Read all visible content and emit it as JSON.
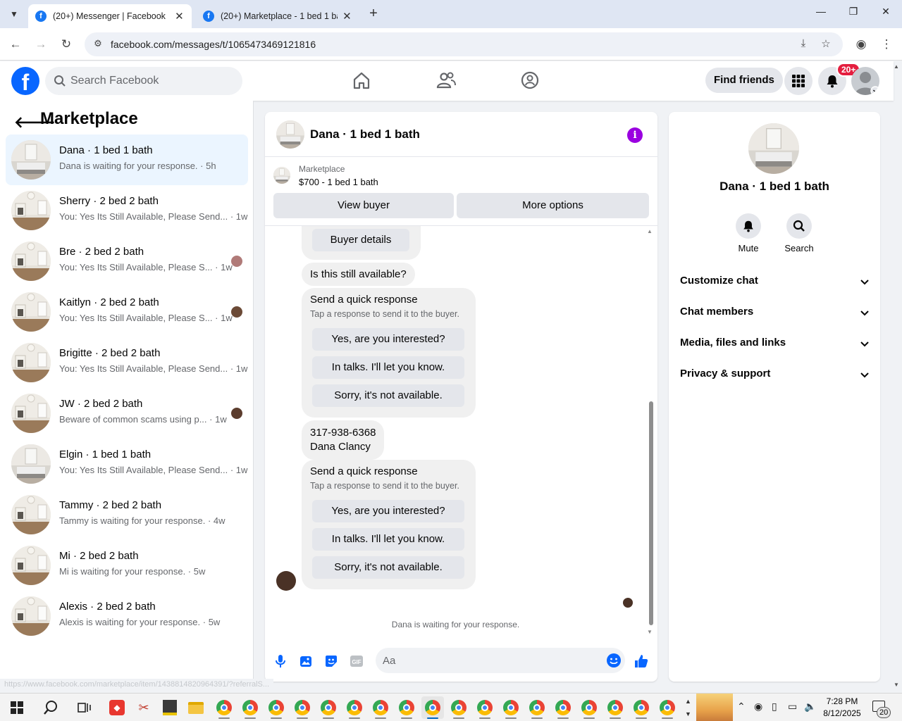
{
  "browser": {
    "tabs": [
      {
        "title": "(20+) Messenger | Facebook",
        "active": true
      },
      {
        "title": "(20+) Marketplace - 1 bed 1 bath",
        "active": false
      }
    ],
    "url": "facebook.com/messages/t/1065473469121816"
  },
  "fbnav": {
    "search_placeholder": "Search Facebook",
    "find_friends": "Find friends",
    "notification_badge": "20+"
  },
  "sidebar": {
    "title": "Marketplace",
    "conversations": [
      {
        "name": "Dana · 1 bed 1 bath",
        "snippet": "Dana is waiting for your response. · 5h",
        "active": true
      },
      {
        "name": "Sherry · 2 bed 2 bath",
        "snippet": "You: Yes Its Still Available, Please Send... · 1w"
      },
      {
        "name": "Bre · 2 bed 2 bath",
        "snippet": "You: Yes Its Still Available, Please S...  · 1w"
      },
      {
        "name": "Kaitlyn · 2 bed 2 bath",
        "snippet": "You: Yes Its Still Available, Please S...  · 1w"
      },
      {
        "name": "Brigitte · 2 bed 2 bath",
        "snippet": "You: Yes Its Still Available, Please Send... · 1w"
      },
      {
        "name": "JW · 2 bed 2 bath",
        "snippet": "Beware of common scams using p...  · 1w"
      },
      {
        "name": "Elgin · 1 bed 1 bath",
        "snippet": "You: Yes Its Still Available, Please Send... · 1w"
      },
      {
        "name": "Tammy · 2 bed 2 bath",
        "snippet": "Tammy is waiting for your response. · 4w"
      },
      {
        "name": "Mi · 2 bed 2 bath",
        "snippet": "Mi is waiting for your response. · 5w"
      },
      {
        "name": "Alexis · 2 bed 2 bath",
        "snippet": "Alexis is waiting for your response. · 5w"
      }
    ]
  },
  "chat": {
    "title": "Dana · 1 bed 1 bath",
    "listing_label": "Marketplace",
    "listing_price": "$700 - 1 bed 1 bath",
    "view_buyer": "View buyer",
    "more_options": "More options",
    "buyer_details": "Buyer details",
    "msg_available": "Is this still available?",
    "quick_response": {
      "heading": "Send a quick response",
      "sub": "Tap a response to send it to the buyer.",
      "options": [
        "Yes, are you interested?",
        "In talks. I'll let you know.",
        "Sorry, it's not available."
      ]
    },
    "contact_phone": "317-938-6368",
    "contact_name": "Dana Clancy",
    "waiting": "Dana is waiting for your response.",
    "input_placeholder": "Aa"
  },
  "info_panel": {
    "name": "Dana · 1 bed 1 bath",
    "mute": "Mute",
    "search": "Search",
    "sections": [
      "Customize chat",
      "Chat members",
      "Media, files and links",
      "Privacy & support"
    ]
  },
  "status_url": "https://www.facebook.com/marketplace/item/1438814820964391/?referralS...",
  "taskbar": {
    "time": "7:28 PM",
    "date": "8/12/2025",
    "notif_count": "20"
  },
  "colors": {
    "fb_blue": "#0866ff",
    "badge_red": "#e41e3f",
    "active_conv": "#ebf5ff",
    "info_purple": "#9a00e0"
  }
}
